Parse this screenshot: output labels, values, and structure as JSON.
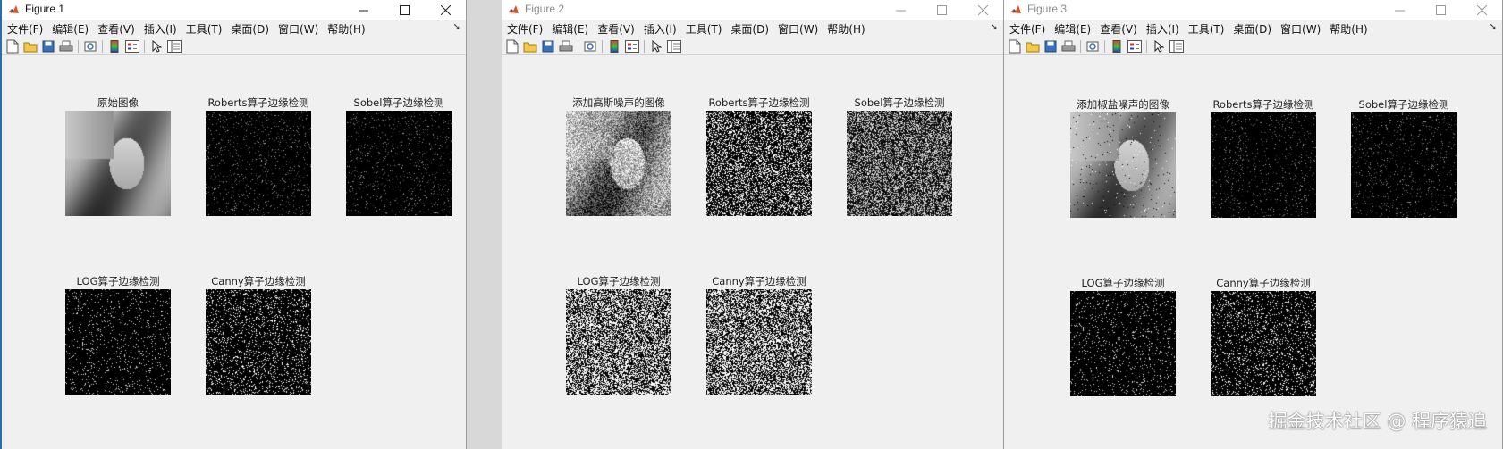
{
  "menu": [
    "文件(F)",
    "编辑(E)",
    "查看(V)",
    "插入(I)",
    "工具(T)",
    "桌面(D)",
    "窗口(W)",
    "帮助(H)"
  ],
  "toolbar_icons": [
    "new-figure-icon",
    "open-file-icon",
    "save-icon",
    "print-icon",
    "print-preview-icon",
    "colorbar-icon",
    "legend-icon",
    "edit-plot-arrow-icon",
    "property-editor-icon"
  ],
  "windows": [
    {
      "title": "Figure 1",
      "active": true,
      "subplots": [
        {
          "title": "原始图像",
          "kind": "gray-image"
        },
        {
          "title": "Roberts算子边缘检测",
          "kind": "edge-faint"
        },
        {
          "title": "Sobel算子边缘检测",
          "kind": "edge-faint"
        },
        {
          "title": "LOG算子边缘检测",
          "kind": "edge-sparse"
        },
        {
          "title": "Canny算子边缘检测",
          "kind": "edge-canny"
        }
      ]
    },
    {
      "title": "Figure 2",
      "active": false,
      "subplots": [
        {
          "title": "添加高斯噪声的图像",
          "kind": "gauss-noisy-image"
        },
        {
          "title": "Roberts算子边缘检测",
          "kind": "noise-medium"
        },
        {
          "title": "Sobel算子边缘检测",
          "kind": "noise-fine"
        },
        {
          "title": "LOG算子边缘检测",
          "kind": "noise-dense"
        },
        {
          "title": "Canny算子边缘检测",
          "kind": "noise-dense"
        }
      ]
    },
    {
      "title": "Figure 3",
      "active": false,
      "subplots": [
        {
          "title": "添加椒盐噪声的图像",
          "kind": "saltpepper-image"
        },
        {
          "title": "Roberts算子边缘检测",
          "kind": "edge-faint"
        },
        {
          "title": "Sobel算子边缘检测",
          "kind": "edge-faint"
        },
        {
          "title": "LOG算子边缘检测",
          "kind": "edge-sparse"
        },
        {
          "title": "Canny算子边缘检测",
          "kind": "edge-canny"
        }
      ]
    }
  ],
  "watermark": "掘金技术社区 @ 程序猿追"
}
